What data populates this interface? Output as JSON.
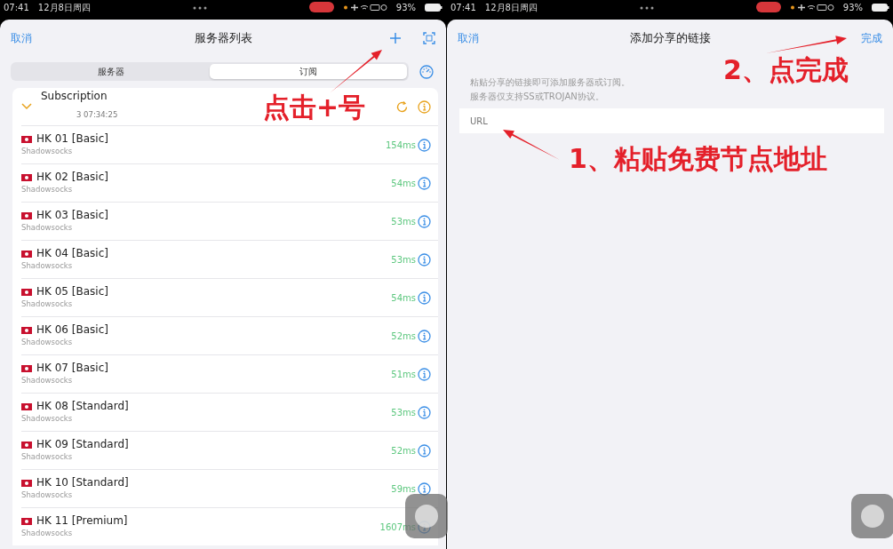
{
  "left_screen": {
    "status_bar": {
      "time": "07:41",
      "date": "12月8日周四",
      "battery": "93%"
    },
    "nav": {
      "cancel": "取消",
      "title": "服务器列表"
    },
    "segments": [
      {
        "label": "服务器",
        "selected": false
      },
      {
        "label": "订阅",
        "selected": true
      }
    ],
    "subscription": {
      "name": "Subscription",
      "updated": "3 07:34:25",
      "expanded": true
    },
    "servers": [
      {
        "name": "HK 01 [Basic]",
        "protocol": "Shadowsocks",
        "latency": "154ms"
      },
      {
        "name": "HK 02 [Basic]",
        "protocol": "Shadowsocks",
        "latency": "54ms"
      },
      {
        "name": "HK 03 [Basic]",
        "protocol": "Shadowsocks",
        "latency": "53ms"
      },
      {
        "name": "HK 04 [Basic]",
        "protocol": "Shadowsocks",
        "latency": "53ms"
      },
      {
        "name": "HK 05 [Basic]",
        "protocol": "Shadowsocks",
        "latency": "54ms"
      },
      {
        "name": "HK 06 [Basic]",
        "protocol": "Shadowsocks",
        "latency": "52ms"
      },
      {
        "name": "HK 07 [Basic]",
        "protocol": "Shadowsocks",
        "latency": "51ms"
      },
      {
        "name": "HK 08 [Standard]",
        "protocol": "Shadowsocks",
        "latency": "53ms"
      },
      {
        "name": "HK 09 [Standard]",
        "protocol": "Shadowsocks",
        "latency": "52ms"
      },
      {
        "name": "HK 10 [Standard]",
        "protocol": "Shadowsocks",
        "latency": "59ms"
      },
      {
        "name": "HK 11 [Premium]",
        "protocol": "Shadowsocks",
        "latency": "1607ms"
      }
    ]
  },
  "right_screen": {
    "status_bar": {
      "time": "07:41",
      "date": "12月8日周四",
      "battery": "93%"
    },
    "nav": {
      "cancel": "取消",
      "title": "添加分享的链接",
      "done": "完成"
    },
    "hint": [
      "粘贴分享的链接即可添加服务器或订阅。",
      "服务器仅支持SS或TROJAN协议。"
    ],
    "url_field": {
      "placeholder": "URL"
    }
  },
  "annotations": [
    {
      "text": "点击+号"
    },
    {
      "text": "2、点完成"
    },
    {
      "text": "1、粘贴免费节点地址"
    }
  ]
}
